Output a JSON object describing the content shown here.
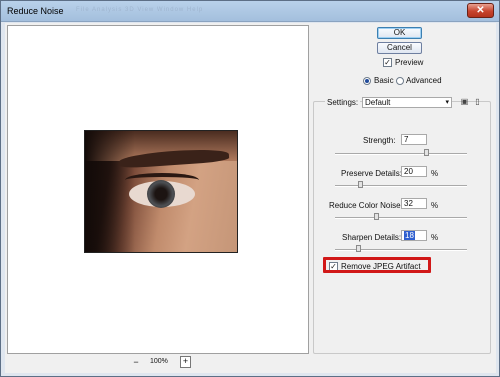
{
  "window": {
    "title": "Reduce Noise",
    "ghost_menu": "File   Analysis   3D   View   Window   Help",
    "close_glyph": "✕"
  },
  "buttons": {
    "ok": "OK",
    "cancel": "Cancel"
  },
  "preview": {
    "label": "Preview",
    "checked": true,
    "check_glyph": "✓"
  },
  "mode": {
    "basic": "Basic",
    "advanced": "Advanced",
    "selected": "Basic"
  },
  "settings": {
    "label": "Settings:",
    "value": "Default",
    "caret": "▾",
    "save_icon": "▣",
    "delete_icon": "▯"
  },
  "controls": {
    "strength": {
      "label": "Strength:",
      "value": "7",
      "unit": "",
      "level": 0.7
    },
    "preserve": {
      "label": "Preserve Details:",
      "value": "20",
      "unit": "%",
      "level": 0.2
    },
    "color_noise": {
      "label": "Reduce Color Noise:",
      "value": "32",
      "unit": "%",
      "level": 0.32
    },
    "sharpen": {
      "label": "Sharpen Details:",
      "value": "18",
      "unit": "%",
      "level": 0.18
    }
  },
  "jpeg": {
    "label": "Remove JPEG Artifact",
    "checked": true,
    "check_glyph": "✓"
  },
  "zoom": {
    "minus": "−",
    "value": "100%",
    "plus": "+"
  },
  "colors": {
    "highlight": "#d11818",
    "accent": "#3c7fb1"
  }
}
